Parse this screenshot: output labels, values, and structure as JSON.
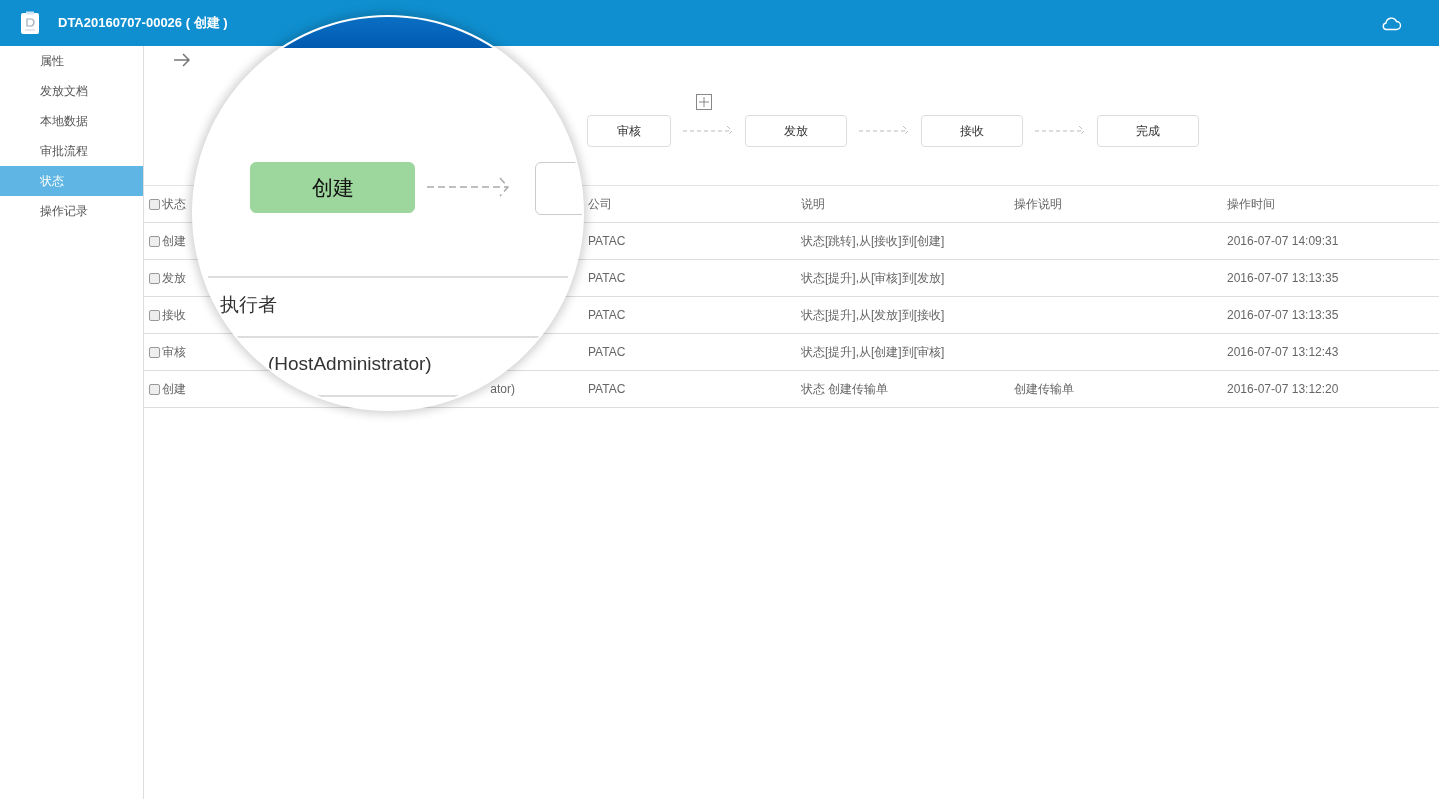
{
  "header": {
    "title": "DTA20160707-00026 ( 创建 )"
  },
  "sidebar": {
    "items": [
      {
        "label": "属性",
        "selected": false
      },
      {
        "label": "发放文档",
        "selected": false
      },
      {
        "label": "本地数据",
        "selected": false
      },
      {
        "label": "审批流程",
        "selected": false
      },
      {
        "label": "状态",
        "selected": true
      },
      {
        "label": "操作记录",
        "selected": false
      }
    ]
  },
  "flow": {
    "steps": [
      {
        "label": "审核",
        "current": false
      },
      {
        "label": "发放",
        "current": false
      },
      {
        "label": "接收",
        "current": false
      },
      {
        "label": "完成",
        "current": false
      }
    ]
  },
  "table": {
    "header": {
      "checked": false,
      "status": "状态",
      "company": "公司",
      "description": "说明",
      "note": "操作说明",
      "time": "操作时间"
    },
    "rows": [
      {
        "checked": false,
        "status": "创建",
        "company": "PATAC",
        "description": "状态[跳转],从[接收]到[创建]",
        "time": "2016-07-07 14:09:31"
      },
      {
        "checked": false,
        "status": "发放",
        "company": "PATAC",
        "description": "状态[提升],从[审核]到[发放]",
        "time": "2016-07-07 13:13:35"
      },
      {
        "checked": false,
        "status": "接收",
        "company": "PATAC",
        "description": "状态[提升],从[发放]到[接收]",
        "time": "2016-07-07 13:13:35"
      },
      {
        "checked": false,
        "status": "审核",
        "company": "PATAC",
        "description": "状态[提升],从[创建]到[审核]",
        "time": "2016-07-07 13:12:43"
      },
      {
        "checked": false,
        "status": "创建",
        "executor": "ator)",
        "company": "PATAC",
        "description": "状态 创建传输单",
        "note": "创建传输单",
        "time": "2016-07-07 13:12:20"
      }
    ]
  },
  "magnifier": {
    "step": {
      "label": "创建",
      "current": true
    },
    "column_label": "执行者",
    "cell": "(HostAdministrator)"
  }
}
